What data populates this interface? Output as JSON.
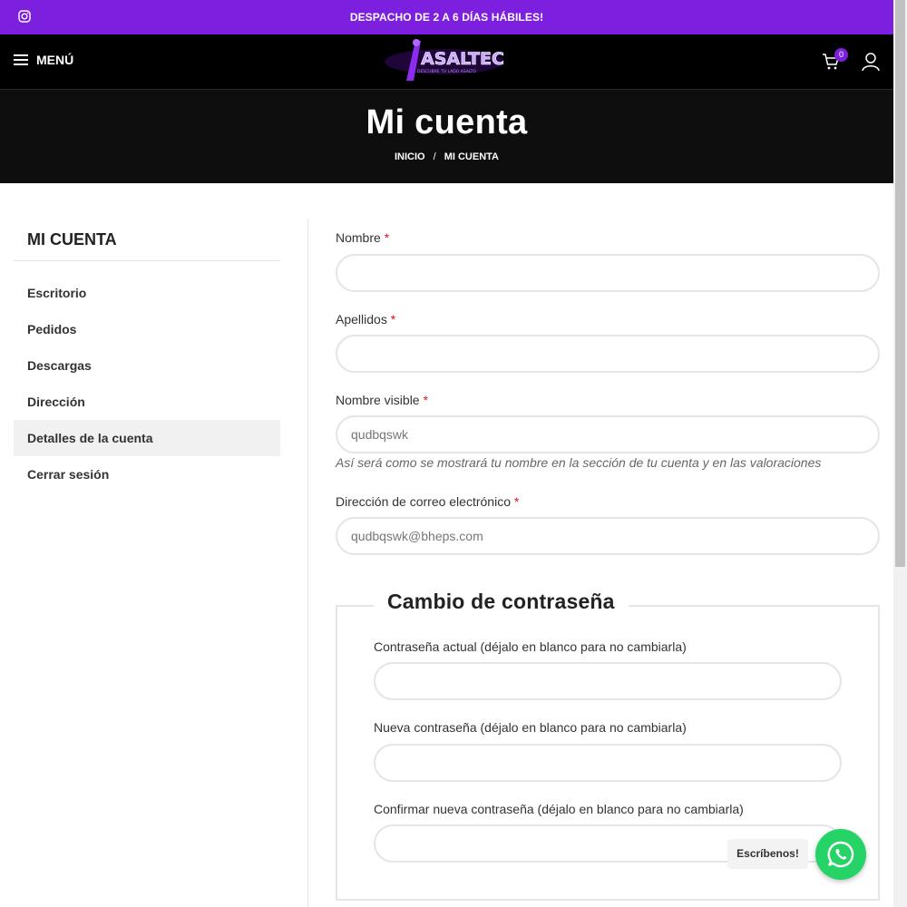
{
  "topbar": {
    "promo": "DESPACHO DE 2 A 6 DÍAS HÁBILES!",
    "icons": [
      "instagram-icon"
    ]
  },
  "header": {
    "menu_label": "MENÚ",
    "logo_text": "ASALTEC",
    "logo_tagline": "DESCUBRE TU LADO ASALTO",
    "cart_count": "0",
    "icons": [
      "hamburger-icon",
      "cart-icon",
      "user-icon"
    ]
  },
  "hero": {
    "title": "Mi cuenta",
    "breadcrumb": {
      "home": "INICIO",
      "separator": "/",
      "current": "MI CUENTA"
    }
  },
  "sidebar": {
    "title": "MI CUENTA",
    "items": [
      {
        "label": "Escritorio"
      },
      {
        "label": "Pedidos"
      },
      {
        "label": "Descargas"
      },
      {
        "label": "Dirección"
      },
      {
        "label": "Detalles de la cuenta",
        "active": true
      },
      {
        "label": "Cerrar sesión"
      }
    ]
  },
  "form": {
    "first_name": {
      "label": "Nombre",
      "required": "*",
      "value": ""
    },
    "last_name": {
      "label": "Apellidos",
      "required": "*",
      "value": ""
    },
    "display_name": {
      "label": "Nombre visible",
      "required": "*",
      "value": "qudbqswk",
      "hint": "Así será como se mostrará tu nombre en la sección de tu cuenta y en las valoraciones"
    },
    "email": {
      "label": "Dirección de correo electrónico",
      "required": "*",
      "value": "qudbqswk@bheps.com"
    }
  },
  "password_change": {
    "legend": "Cambio de contraseña",
    "current": {
      "label": "Contraseña actual (déjalo en blanco para no cambiarla)",
      "value": ""
    },
    "new": {
      "label": "Nueva contraseña (déjalo en blanco para no cambiarla)",
      "value": ""
    },
    "confirm": {
      "label": "Confirmar nueva contraseña (déjalo en blanco para no cambiarla)",
      "value": ""
    }
  },
  "chat": {
    "label": "Escríbenos!",
    "icon": "whatsapp-icon"
  },
  "colors": {
    "accent": "#7d1fde",
    "header_bg": "#000000",
    "hero_bg": "#0e0e0e",
    "whatsapp": "#25d366",
    "required": "#e01020"
  }
}
